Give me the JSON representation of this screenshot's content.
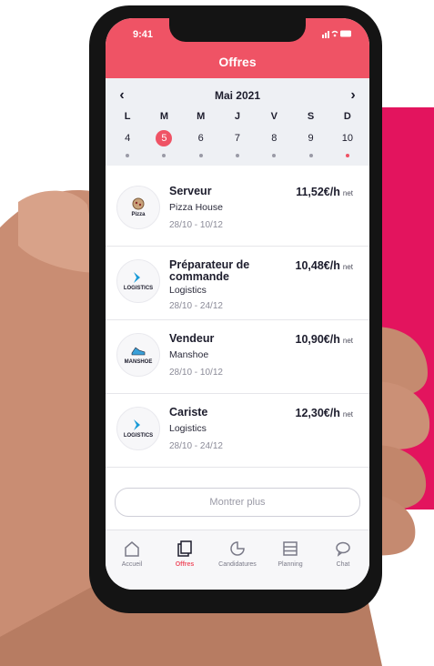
{
  "status_bar": {
    "time": "9:41",
    "icons": "signal wifi battery"
  },
  "header": {
    "title": "Offres"
  },
  "calendar": {
    "month": "Mai 2021",
    "weekdays": [
      "L",
      "M",
      "M",
      "J",
      "V",
      "S",
      "D"
    ],
    "days": [
      "4",
      "5",
      "6",
      "7",
      "8",
      "9",
      "10"
    ],
    "selected_day": "5",
    "today_dot_day": "10"
  },
  "offers": [
    {
      "job": "Serveur",
      "company": "Pizza House",
      "dates": "28/10 - 10/12",
      "rate": "11,52€/h",
      "rate_suffix": "net",
      "logo_text": "Pizza"
    },
    {
      "job": "Préparateur de commande",
      "company": "Logistics",
      "dates": "28/10 - 24/12",
      "rate": "10,48€/h",
      "rate_suffix": "net",
      "logo_text": "LOGISTICS"
    },
    {
      "job": "Vendeur",
      "company": "Manshoe",
      "dates": "28/10 - 10/12",
      "rate": "10,90€/h",
      "rate_suffix": "net",
      "logo_text": "MANSHOE"
    },
    {
      "job": "Cariste",
      "company": "Logistics",
      "dates": "28/10 - 24/12",
      "rate": "12,30€/h",
      "rate_suffix": "net",
      "logo_text": "LOGISTICS"
    }
  ],
  "more_button": "Montrer plus",
  "tabs": [
    {
      "label": "Accueil",
      "icon": "home-icon"
    },
    {
      "label": "Offres",
      "icon": "offers-icon",
      "active": true
    },
    {
      "label": "Candidatures",
      "icon": "applications-icon"
    },
    {
      "label": "Planning",
      "icon": "planning-icon"
    },
    {
      "label": "Chat",
      "icon": "chat-icon"
    }
  ],
  "colors": {
    "accent": "#ef5365",
    "backdrop": "#e3145e",
    "logistics_blue": "#1a9bd7"
  }
}
